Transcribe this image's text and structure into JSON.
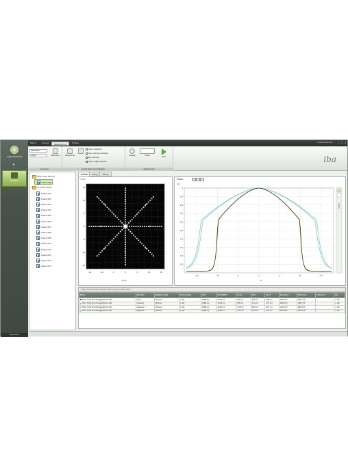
{
  "app": {
    "name": "myQA FastTrack",
    "brand": "iba",
    "user": "Andreas Henning",
    "footer": "Data Status"
  },
  "sidebar": {
    "measure_label": "Measure"
  },
  "topbar": {
    "menu": "Main ▾",
    "tabs": [
      "Frames",
      "Measurement",
      "Profiles"
    ],
    "active_tab": "Measurement"
  },
  "ribbon": {
    "equipment": {
      "label": "Equipment",
      "device_combo": "StarTrack2",
      "detector_combo": "Array 1",
      "disconnect": "Disconnect"
    },
    "status": {
      "label": "Device Status and Calibration",
      "background": "Background",
      "options": [
        "Output calibration",
        "Gain uniformity correction",
        "Bkg correction",
        "Gantry angle correction"
      ]
    },
    "measurement": {
      "label": "Measurement",
      "settings": "Settings",
      "mode": "Online",
      "start": "Start"
    }
  },
  "tree": {
    "nodes": [
      {
        "label": "OFG: 6 MV FFF 20",
        "level": 0,
        "type": "folder"
      },
      {
        "label": "Frame 001",
        "level": 1,
        "type": "doc",
        "selected": true
      },
      {
        "label": "17.10.XX Online",
        "level": 0,
        "type": "folder"
      },
      {
        "label": "Frame 001",
        "level": 1,
        "type": "doc"
      },
      {
        "label": "Frame 002",
        "level": 1,
        "type": "doc"
      },
      {
        "label": "Frame 003",
        "level": 1,
        "type": "doc"
      },
      {
        "label": "Frame 004",
        "level": 1,
        "type": "doc"
      },
      {
        "label": "Frame 005",
        "level": 1,
        "type": "doc"
      },
      {
        "label": "Frame 006",
        "level": 1,
        "type": "doc"
      },
      {
        "label": "Frame 007",
        "level": 1,
        "type": "doc"
      },
      {
        "label": "Frame 008",
        "level": 1,
        "type": "doc"
      },
      {
        "label": "Frame 009",
        "level": 1,
        "type": "doc"
      },
      {
        "label": "Frame 010",
        "level": 1,
        "type": "doc"
      },
      {
        "label": "Frame 011",
        "level": 1,
        "type": "doc"
      },
      {
        "label": "Frame 012",
        "level": 1,
        "type": "doc"
      },
      {
        "label": "Frame 013",
        "level": 1,
        "type": "doc"
      },
      {
        "label": "Frame 014",
        "level": 1,
        "type": "doc"
      }
    ]
  },
  "views": {
    "tabs": [
      "Profiles",
      "Energy",
      "Startup"
    ],
    "active": "Profiles"
  },
  "left_plot": {
    "y_label": "Y [cm]",
    "x_label": "X [cm]",
    "ticks": [
      "-15",
      "-10",
      "-5",
      "0",
      "5",
      "10",
      "15"
    ]
  },
  "profiles": {
    "title": "Profiles",
    "ylabel": "Dp",
    "xlabel": "cm",
    "side_label": "Profiles",
    "y_ticks": [
      "1",
      "0.9",
      "0.8",
      "0.7",
      "0.6",
      "0.5",
      "0.4",
      "0.3",
      "0.2",
      "0.1"
    ],
    "x_ticks": [
      "-15",
      "-10",
      "-5",
      "0",
      "5",
      "10",
      "15"
    ],
    "colors": {
      "inline": "#2a2a2a",
      "crossline": "#c8a022",
      "diagonal_a": "#74c6a8",
      "diagonal_b": "#7bbfd8"
    }
  },
  "table": {
    "hint": "Drag a column header and drop it here to group by that column",
    "columns": [
      "Name",
      "Direction",
      "Radiation Type",
      "Gantry Angle",
      "CAX",
      "Field Width",
      "Center",
      "Pen L",
      "Pen R",
      "Symmetry",
      "Flatness IL",
      "Flatness X",
      "Flat"
    ],
    "rows": [
      {
        "dot": "#222222",
        "cells": [
          "OFG: 6 MV FFF 20\\Loggo\\Frame 001",
          "Inline",
          "Photons",
          "n. def.",
          "0.986 Gy",
          "19.84 cm",
          "0.03 cm",
          "2.86 cm",
          "2.83 cm",
          "100.66 %",
          "109.74 %",
          "",
          "n. def"
        ]
      },
      {
        "dot": "#c8a022",
        "cells": [
          "OFG: 6 MV FFF 20\\Loggo\\Frame 001",
          "Crossline",
          "Photons",
          "n. def.",
          "0.986 Gy",
          "19.64 cm",
          "0.05 cm",
          "3.24 cm",
          "3.37 cm",
          "100.83 %",
          "108.74 %",
          "",
          "n. def"
        ]
      },
      {
        "dot": "#74c6a8",
        "cells": [
          "OFG: 6 MV FFF 20\\Loggo\\Frame 001",
          "Diagonal ->",
          "Photons",
          "n. def.",
          "0.986 Gy",
          "28.06 cm",
          "-0.08 cm",
          "6.83 cm",
          "6.67 cm",
          "101.63 %",
          "185.29 %",
          "",
          "n. def"
        ]
      },
      {
        "dot": "#7bbfd8",
        "cells": [
          "OFG: 6 MV FFF 20\\Loggo\\Frame 001",
          "Diagonal <-",
          "Photons",
          "n. def.",
          "0.986 Gy",
          "28.06 cm",
          "-0.01 cm",
          "6.74 cm",
          "6.79 cm",
          "101.48 %",
          "187.74 %",
          "",
          "n. def"
        ]
      }
    ]
  }
}
